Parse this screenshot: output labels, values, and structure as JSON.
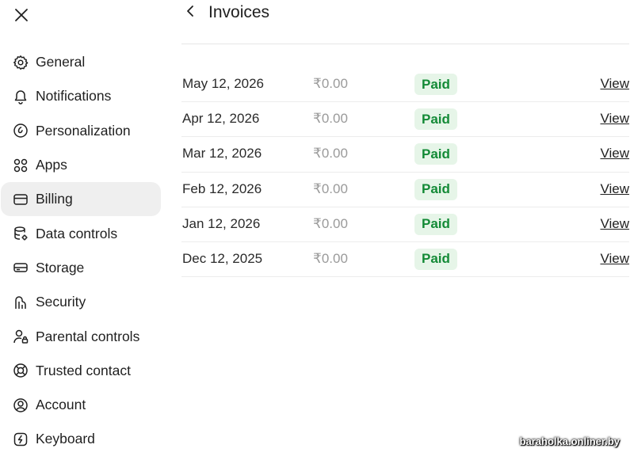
{
  "header": {
    "title": "Invoices"
  },
  "sidebar": {
    "items": [
      {
        "label": "General",
        "icon": "gear-icon"
      },
      {
        "label": "Notifications",
        "icon": "bell-icon"
      },
      {
        "label": "Personalization",
        "icon": "personalization-icon"
      },
      {
        "label": "Apps",
        "icon": "apps-grid-icon"
      },
      {
        "label": "Billing",
        "icon": "credit-card-icon",
        "active": true
      },
      {
        "label": "Data controls",
        "icon": "database-gear-icon"
      },
      {
        "label": "Storage",
        "icon": "storage-icon"
      },
      {
        "label": "Security",
        "icon": "key-icon"
      },
      {
        "label": "Parental controls",
        "icon": "person-lock-icon"
      },
      {
        "label": "Trusted contact",
        "icon": "lifebuoy-icon"
      },
      {
        "label": "Account",
        "icon": "account-circle-icon"
      },
      {
        "label": "Keyboard",
        "icon": "keyboard-icon"
      }
    ]
  },
  "invoices": [
    {
      "date": "May 12, 2026",
      "amount": "₹0.00",
      "status": "Paid",
      "action": "View"
    },
    {
      "date": "Apr 12, 2026",
      "amount": "₹0.00",
      "status": "Paid",
      "action": "View"
    },
    {
      "date": "Mar 12, 2026",
      "amount": "₹0.00",
      "status": "Paid",
      "action": "View"
    },
    {
      "date": "Feb 12, 2026",
      "amount": "₹0.00",
      "status": "Paid",
      "action": "View"
    },
    {
      "date": "Jan 12, 2026",
      "amount": "₹0.00",
      "status": "Paid",
      "action": "View"
    },
    {
      "date": "Dec 12, 2025",
      "amount": "₹0.00",
      "status": "Paid",
      "action": "View"
    }
  ],
  "colors": {
    "paid_badge_bg": "#e6f5e8",
    "paid_badge_text": "#138a36",
    "active_nav_bg": "#efefef"
  },
  "watermark": "baraholka.onliner.by"
}
